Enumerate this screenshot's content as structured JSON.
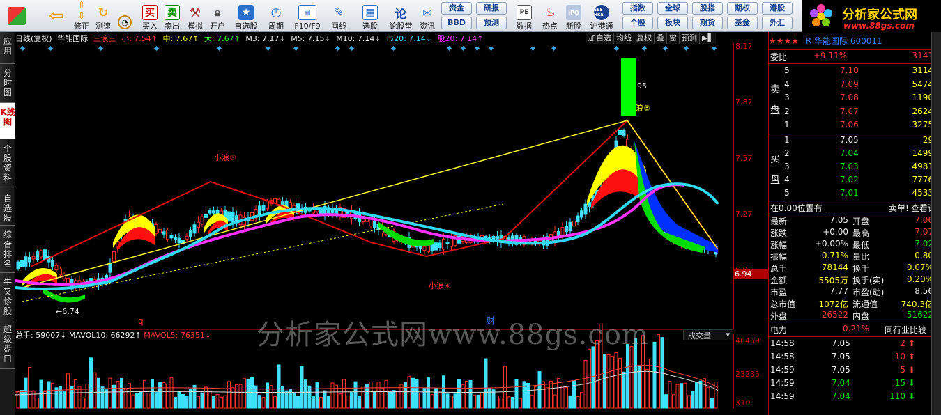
{
  "toolbar": {
    "buttons": [
      {
        "label": "修正"
      },
      {
        "label": "测速"
      },
      {
        "label": "买入"
      },
      {
        "label": "卖出"
      },
      {
        "label": "模拟"
      },
      {
        "label": "开户"
      },
      {
        "label": "自选股"
      },
      {
        "label": "周期"
      },
      {
        "label": "F10/F9"
      },
      {
        "label": "画线"
      },
      {
        "label": "选股"
      },
      {
        "label": "论股堂"
      },
      {
        "label": "资讯"
      },
      {
        "label": "数据"
      },
      {
        "label": "热点"
      },
      {
        "label": "新股"
      },
      {
        "label": "沪港通"
      }
    ],
    "grid1": [
      "资金",
      "研报",
      "BBD",
      "预测"
    ],
    "grid2": [
      "指数",
      "全球",
      "股指",
      "期权",
      "港股",
      "个股",
      "板块",
      "期货",
      "基金",
      "外汇"
    ],
    "buy_icon": "买",
    "sell_icon": "卖",
    "f10_icon": "论",
    "pe_icon": "PE",
    "ipo_icon": "IPO",
    "hk_icon": "SSE HKE"
  },
  "brand": {
    "title": "分析家公式网",
    "url": "www.88gs.com"
  },
  "sidebar": {
    "tabs": [
      "应用",
      "分时图",
      "K线图",
      "个股资料",
      "自选股",
      "综合排名",
      "牛叉诊股",
      "超级盘口"
    ]
  },
  "chart": {
    "header": {
      "period": "日线(复权)",
      "name": "华能国际",
      "indicator": "三浪三",
      "small": "小: 7.54↑",
      "mid": "中: 7.67↑",
      "big": "大: 7.67↑",
      "m3": "M3: 7.17↓",
      "m5": "M5: 7.15↓",
      "m10": "M10: 7.14↓",
      "city20": "市20: 7.14↓",
      "stock20": "股20: 7.14↑"
    },
    "tools": [
      "加自选",
      "均线",
      "复权",
      "叠",
      "窗",
      "预测",
      "▶▌"
    ],
    "price_labels": [
      "8.17",
      "7.87",
      "7.57",
      "7.27",
      "6.97"
    ],
    "current_price": "6.94",
    "annotations": {
      "wave3": "小浪③",
      "wave4": "小浪④",
      "wave5": "浪⑤",
      "high_label": "95",
      "low_label": "6.74",
      "q_mark": "q",
      "cai_mark": "财"
    },
    "colors": {
      "ribbon_red": "#ff1010",
      "ribbon_yellow": "#ffff00",
      "ribbon_green": "#00dd00",
      "ribbon_blue": "#0030ff",
      "ma_cyan": "#30d8f0",
      "ma_magenta": "#ff30ff",
      "trend_red": "#dd1010",
      "trend_yellow": "#ffff30"
    }
  },
  "volume": {
    "total": "总手: 59007↓",
    "mavol10": "MAVOL10: 66292↑",
    "mavol5": "MAVOL5: 76351↓",
    "dropdown": "成交量",
    "axis": [
      "46469",
      "23235",
      "X10"
    ]
  },
  "watermark": "分析家公式网www.88gs.com",
  "quote": {
    "stars": "★★★★",
    "code_name": "R 华能国际 600011",
    "weibi_label": "委比",
    "weibi_value": "+9.11%",
    "weibi_diff": "3141",
    "sell_label": "卖盘",
    "sells": [
      {
        "level": "5",
        "price": "7.10",
        "vol": "3114"
      },
      {
        "level": "4",
        "price": "7.09",
        "vol": "5474"
      },
      {
        "level": "3",
        "price": "7.08",
        "vol": "1190"
      },
      {
        "level": "2",
        "price": "7.07",
        "vol": "2624"
      },
      {
        "level": "1",
        "price": "7.06",
        "vol": "3275"
      }
    ],
    "buy_label": "买盘",
    "buys": [
      {
        "level": "1",
        "price": "7.05",
        "vol": "29"
      },
      {
        "level": "2",
        "price": "7.04",
        "vol": "1499"
      },
      {
        "level": "3",
        "price": "7.03",
        "vol": "4981"
      },
      {
        "level": "4",
        "price": "7.02",
        "vol": "7776"
      },
      {
        "level": "5",
        "price": "7.01",
        "vol": "4533"
      }
    ],
    "position_text": "在0.00位置有",
    "sell_single": "卖单!",
    "view_detail": "查看详细",
    "stats": [
      {
        "k1": "最新",
        "v1": "7.05",
        "k2": "开盘",
        "v2": "7.06",
        "c1": "wht",
        "c2": "red"
      },
      {
        "k1": "涨跌",
        "v1": "+0.00",
        "k2": "最高",
        "v2": "7.07",
        "c1": "wht",
        "c2": "red"
      },
      {
        "k1": "涨幅",
        "v1": "+0.00%",
        "k2": "最低",
        "v2": "7.02",
        "c1": "wht",
        "c2": "grn"
      },
      {
        "k1": "振幅",
        "v1": "0.71%",
        "k2": "量比",
        "v2": "0.80",
        "c1": "yel",
        "c2": "yel"
      },
      {
        "k1": "总手",
        "v1": "78144",
        "k2": "换手",
        "v2": "0.07%",
        "c1": "yel",
        "c2": "yel"
      },
      {
        "k1": "金额",
        "v1": "5505万",
        "k2": "换手(实)",
        "v2": "0.20%",
        "c1": "yel",
        "c2": "yel"
      },
      {
        "k1": "市盈",
        "v1": "7.77",
        "k2": "市盈(动)",
        "v2": "8.56",
        "c1": "wht",
        "c2": "wht"
      },
      {
        "k1": "总市值",
        "v1": "1072亿",
        "k2": "流通值",
        "v2": "740.3亿",
        "c1": "yel",
        "c2": "yel"
      },
      {
        "k1": "外盘",
        "v1": "26522",
        "k2": "内盘",
        "v2": "51622",
        "c1": "red",
        "c2": "grn"
      }
    ],
    "industry": "电力",
    "industry_pct": "0.21%",
    "peer_compare": "同行业比较",
    "ticks": [
      {
        "time": "14:58",
        "price": "7.05",
        "vol": "2",
        "dir": "up"
      },
      {
        "time": "14:58",
        "price": "7.05",
        "vol": "10",
        "dir": "up"
      },
      {
        "time": "14:59",
        "price": "7.05",
        "vol": "5",
        "dir": "up"
      },
      {
        "time": "14:59",
        "price": "7.04",
        "vol": "15",
        "dir": "down"
      },
      {
        "time": "14:59",
        "price": "7.04",
        "vol": "110",
        "dir": "down"
      }
    ]
  }
}
